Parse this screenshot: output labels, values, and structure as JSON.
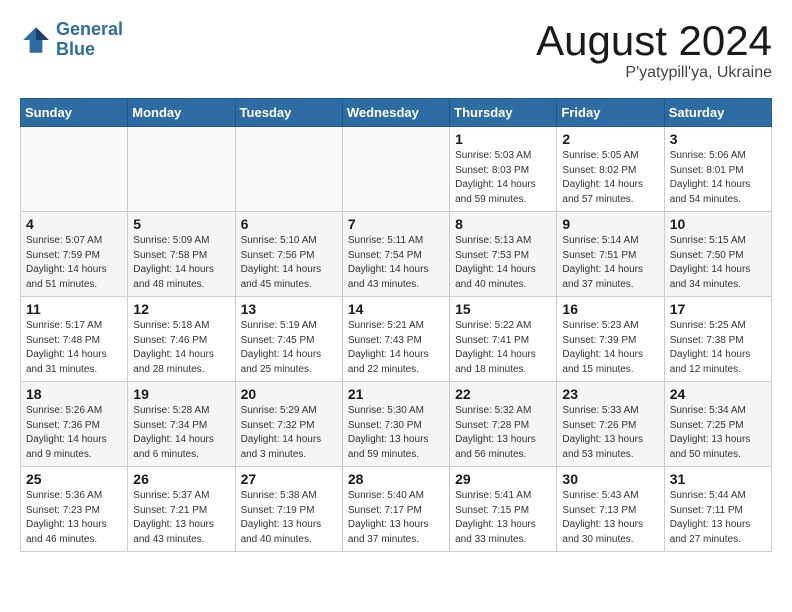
{
  "header": {
    "logo_line1": "General",
    "logo_line2": "Blue",
    "month": "August 2024",
    "location": "P'yatypill'ya, Ukraine"
  },
  "weekdays": [
    "Sunday",
    "Monday",
    "Tuesday",
    "Wednesday",
    "Thursday",
    "Friday",
    "Saturday"
  ],
  "weeks": [
    [
      {
        "day": "",
        "detail": ""
      },
      {
        "day": "",
        "detail": ""
      },
      {
        "day": "",
        "detail": ""
      },
      {
        "day": "",
        "detail": ""
      },
      {
        "day": "1",
        "detail": "Sunrise: 5:03 AM\nSunset: 8:03 PM\nDaylight: 14 hours\nand 59 minutes."
      },
      {
        "day": "2",
        "detail": "Sunrise: 5:05 AM\nSunset: 8:02 PM\nDaylight: 14 hours\nand 57 minutes."
      },
      {
        "day": "3",
        "detail": "Sunrise: 5:06 AM\nSunset: 8:01 PM\nDaylight: 14 hours\nand 54 minutes."
      }
    ],
    [
      {
        "day": "4",
        "detail": "Sunrise: 5:07 AM\nSunset: 7:59 PM\nDaylight: 14 hours\nand 51 minutes."
      },
      {
        "day": "5",
        "detail": "Sunrise: 5:09 AM\nSunset: 7:58 PM\nDaylight: 14 hours\nand 48 minutes."
      },
      {
        "day": "6",
        "detail": "Sunrise: 5:10 AM\nSunset: 7:56 PM\nDaylight: 14 hours\nand 45 minutes."
      },
      {
        "day": "7",
        "detail": "Sunrise: 5:11 AM\nSunset: 7:54 PM\nDaylight: 14 hours\nand 43 minutes."
      },
      {
        "day": "8",
        "detail": "Sunrise: 5:13 AM\nSunset: 7:53 PM\nDaylight: 14 hours\nand 40 minutes."
      },
      {
        "day": "9",
        "detail": "Sunrise: 5:14 AM\nSunset: 7:51 PM\nDaylight: 14 hours\nand 37 minutes."
      },
      {
        "day": "10",
        "detail": "Sunrise: 5:15 AM\nSunset: 7:50 PM\nDaylight: 14 hours\nand 34 minutes."
      }
    ],
    [
      {
        "day": "11",
        "detail": "Sunrise: 5:17 AM\nSunset: 7:48 PM\nDaylight: 14 hours\nand 31 minutes."
      },
      {
        "day": "12",
        "detail": "Sunrise: 5:18 AM\nSunset: 7:46 PM\nDaylight: 14 hours\nand 28 minutes."
      },
      {
        "day": "13",
        "detail": "Sunrise: 5:19 AM\nSunset: 7:45 PM\nDaylight: 14 hours\nand 25 minutes."
      },
      {
        "day": "14",
        "detail": "Sunrise: 5:21 AM\nSunset: 7:43 PM\nDaylight: 14 hours\nand 22 minutes."
      },
      {
        "day": "15",
        "detail": "Sunrise: 5:22 AM\nSunset: 7:41 PM\nDaylight: 14 hours\nand 18 minutes."
      },
      {
        "day": "16",
        "detail": "Sunrise: 5:23 AM\nSunset: 7:39 PM\nDaylight: 14 hours\nand 15 minutes."
      },
      {
        "day": "17",
        "detail": "Sunrise: 5:25 AM\nSunset: 7:38 PM\nDaylight: 14 hours\nand 12 minutes."
      }
    ],
    [
      {
        "day": "18",
        "detail": "Sunrise: 5:26 AM\nSunset: 7:36 PM\nDaylight: 14 hours\nand 9 minutes."
      },
      {
        "day": "19",
        "detail": "Sunrise: 5:28 AM\nSunset: 7:34 PM\nDaylight: 14 hours\nand 6 minutes."
      },
      {
        "day": "20",
        "detail": "Sunrise: 5:29 AM\nSunset: 7:32 PM\nDaylight: 14 hours\nand 3 minutes."
      },
      {
        "day": "21",
        "detail": "Sunrise: 5:30 AM\nSunset: 7:30 PM\nDaylight: 13 hours\nand 59 minutes."
      },
      {
        "day": "22",
        "detail": "Sunrise: 5:32 AM\nSunset: 7:28 PM\nDaylight: 13 hours\nand 56 minutes."
      },
      {
        "day": "23",
        "detail": "Sunrise: 5:33 AM\nSunset: 7:26 PM\nDaylight: 13 hours\nand 53 minutes."
      },
      {
        "day": "24",
        "detail": "Sunrise: 5:34 AM\nSunset: 7:25 PM\nDaylight: 13 hours\nand 50 minutes."
      }
    ],
    [
      {
        "day": "25",
        "detail": "Sunrise: 5:36 AM\nSunset: 7:23 PM\nDaylight: 13 hours\nand 46 minutes."
      },
      {
        "day": "26",
        "detail": "Sunrise: 5:37 AM\nSunset: 7:21 PM\nDaylight: 13 hours\nand 43 minutes."
      },
      {
        "day": "27",
        "detail": "Sunrise: 5:38 AM\nSunset: 7:19 PM\nDaylight: 13 hours\nand 40 minutes."
      },
      {
        "day": "28",
        "detail": "Sunrise: 5:40 AM\nSunset: 7:17 PM\nDaylight: 13 hours\nand 37 minutes."
      },
      {
        "day": "29",
        "detail": "Sunrise: 5:41 AM\nSunset: 7:15 PM\nDaylight: 13 hours\nand 33 minutes."
      },
      {
        "day": "30",
        "detail": "Sunrise: 5:43 AM\nSunset: 7:13 PM\nDaylight: 13 hours\nand 30 minutes."
      },
      {
        "day": "31",
        "detail": "Sunrise: 5:44 AM\nSunset: 7:11 PM\nDaylight: 13 hours\nand 27 minutes."
      }
    ]
  ]
}
